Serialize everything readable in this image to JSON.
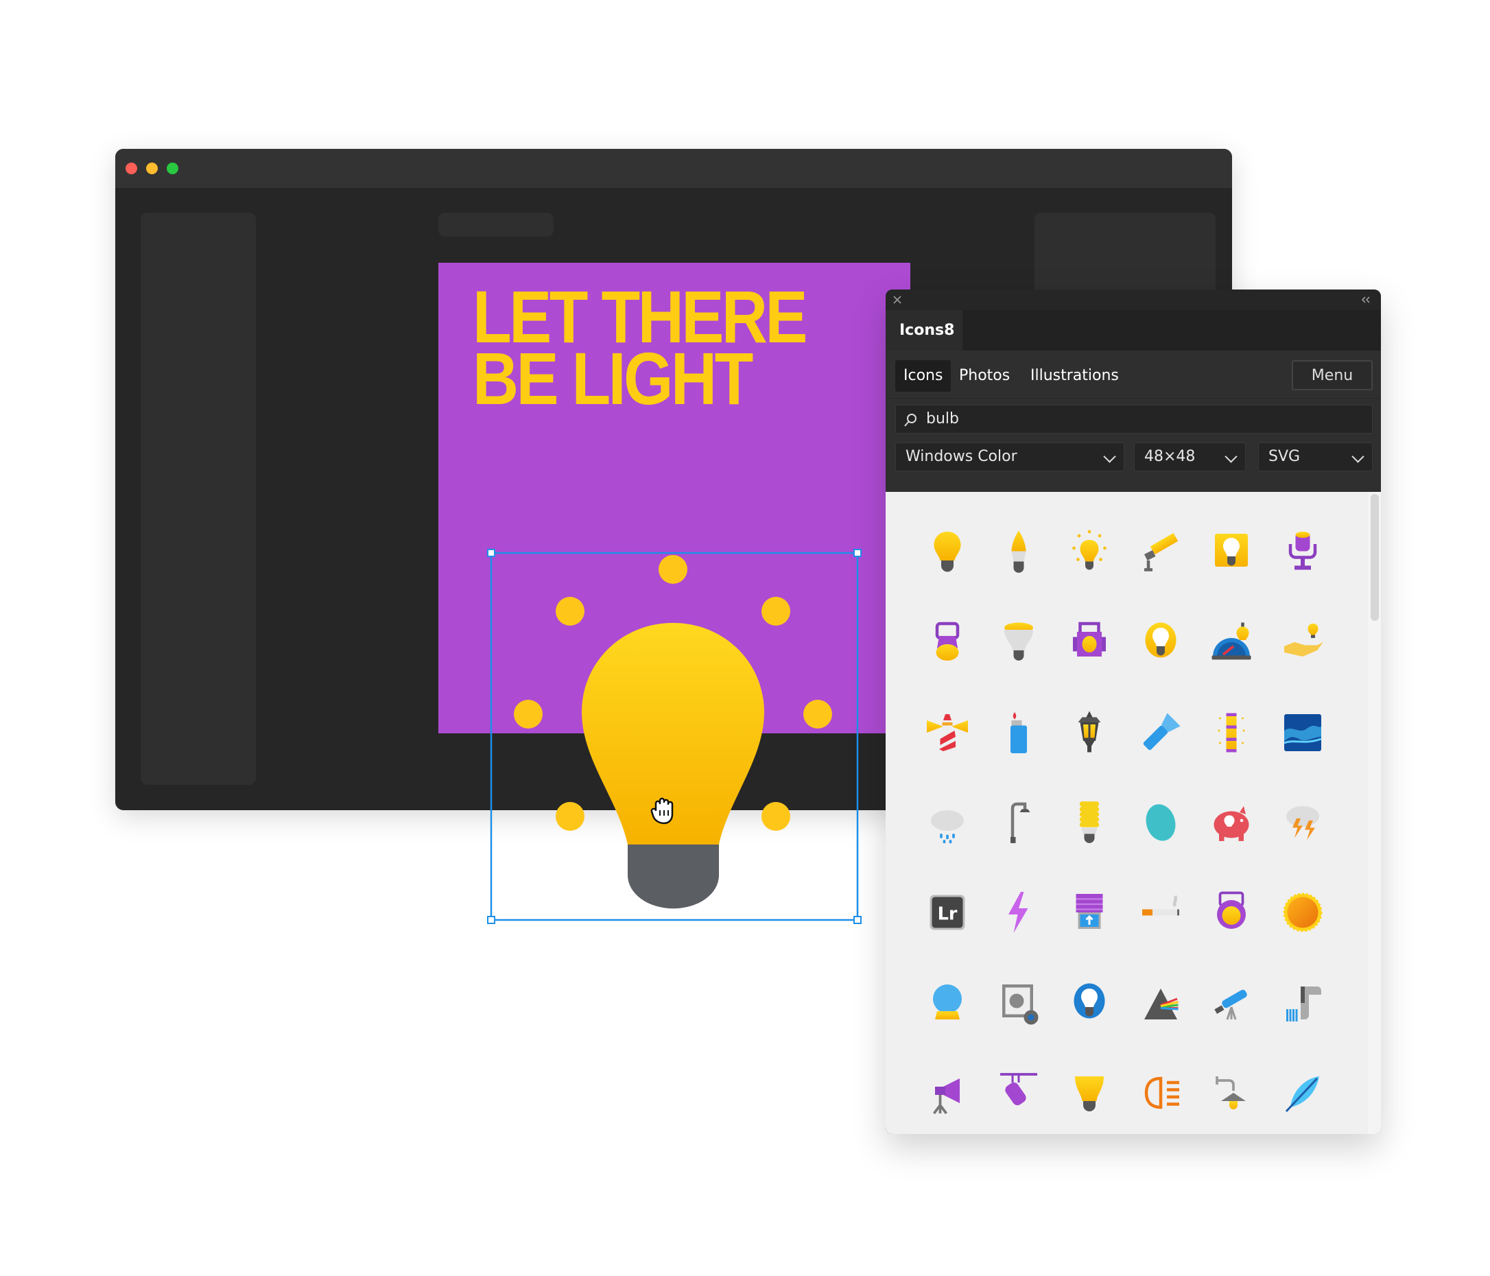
{
  "window": {
    "traffic_lights": {
      "close": "#ff5f57",
      "minimize": "#febc2e",
      "maximize": "#28c840"
    }
  },
  "artboard": {
    "background": "#ad4bd3",
    "headline_line1": "LET THERE",
    "headline_line2": "BE LIGHT",
    "headline_color": "#ffcc14"
  },
  "selection": {
    "color": "#1e90e8",
    "cursor": "grab-hand-icon"
  },
  "panel": {
    "close_icon": "close-icon",
    "collapse_icon": "double-chevron-left-icon",
    "tab_title": "Icons8",
    "nav": [
      {
        "label": "Icons",
        "active": true
      },
      {
        "label": "Photos",
        "active": false
      },
      {
        "label": "Illustrations",
        "active": false
      }
    ],
    "menu_label": "Menu",
    "search": {
      "value": "bulb",
      "icon": "search-icon"
    },
    "style_select": "Windows Color",
    "size_select": "48×48",
    "format_select": "SVG",
    "icons": [
      {
        "name": "light-bulb"
      },
      {
        "name": "candle-bulb"
      },
      {
        "name": "idea-bulb"
      },
      {
        "name": "spotlight"
      },
      {
        "name": "bulb-square"
      },
      {
        "name": "stage-light"
      },
      {
        "name": "lantern"
      },
      {
        "name": "led-reflector-bulb"
      },
      {
        "name": "theatre-spotlight"
      },
      {
        "name": "glowing-bulb"
      },
      {
        "name": "speedometer-bulb"
      },
      {
        "name": "hand-with-bulb"
      },
      {
        "name": "lighthouse"
      },
      {
        "name": "lighter"
      },
      {
        "name": "street-lantern"
      },
      {
        "name": "flashlight"
      },
      {
        "name": "light-tube"
      },
      {
        "name": "aurora"
      },
      {
        "name": "rain-cloud"
      },
      {
        "name": "street-lamp"
      },
      {
        "name": "cfl-bulb"
      },
      {
        "name": "egg-lamp"
      },
      {
        "name": "piggy-bank-bulb"
      },
      {
        "name": "thunderstorm"
      },
      {
        "name": "lightroom",
        "logo_text": "Lr"
      },
      {
        "name": "lightning-bolt"
      },
      {
        "name": "window-blinds"
      },
      {
        "name": "cigarette"
      },
      {
        "name": "stage-spotlight"
      },
      {
        "name": "sun"
      },
      {
        "name": "crystal-ball"
      },
      {
        "name": "brightness-settings"
      },
      {
        "name": "blue-bulb"
      },
      {
        "name": "prism"
      },
      {
        "name": "telescope"
      },
      {
        "name": "barcode-scanner"
      },
      {
        "name": "studio-light"
      },
      {
        "name": "track-light"
      },
      {
        "name": "reflector-bulb"
      },
      {
        "name": "headlight"
      },
      {
        "name": "wall-lamp"
      },
      {
        "name": "feather"
      }
    ]
  }
}
